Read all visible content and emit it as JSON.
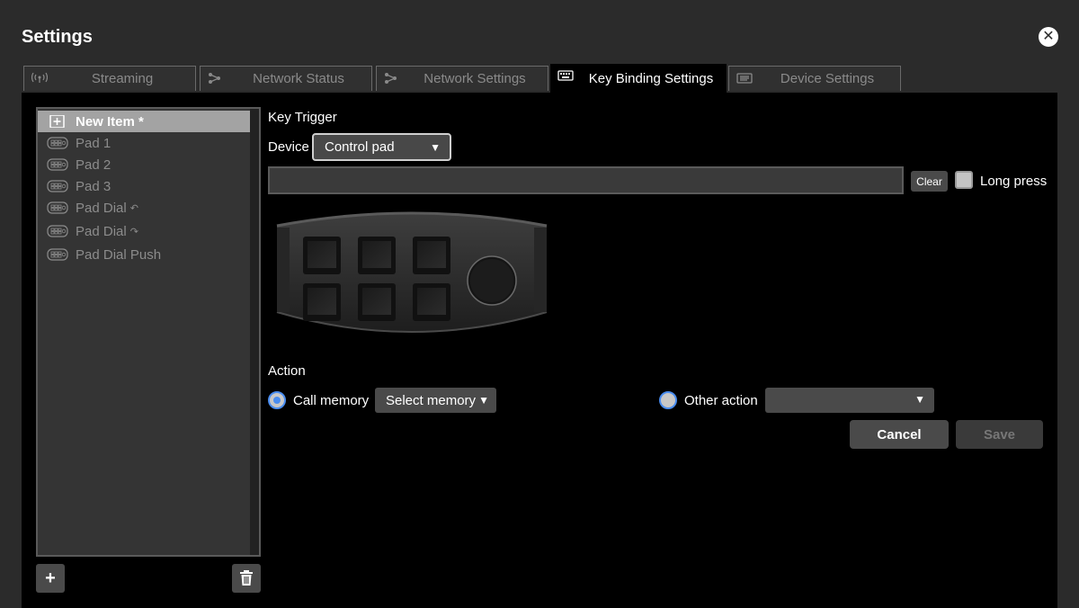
{
  "window": {
    "title": "Settings"
  },
  "tabs": [
    {
      "label": "Streaming",
      "icon": "broadcast-icon"
    },
    {
      "label": "Network Status",
      "icon": "network-icon"
    },
    {
      "label": "Network Settings",
      "icon": "network-icon"
    },
    {
      "label": "Key Binding Settings",
      "icon": "keyboard-icon"
    },
    {
      "label": "Device Settings",
      "icon": "device-icon"
    }
  ],
  "active_tab": "Key Binding Settings",
  "sidebar": {
    "items": [
      {
        "label": "New Item *",
        "icon": "add-box-icon",
        "selected": true
      },
      {
        "label": "Pad 1",
        "icon": "control-pad-icon"
      },
      {
        "label": "Pad 2",
        "icon": "control-pad-icon"
      },
      {
        "label": "Pad 3",
        "icon": "control-pad-icon"
      },
      {
        "label": "Pad Dial",
        "icon": "control-pad-icon",
        "suffix": "↶"
      },
      {
        "label": "Pad Dial",
        "icon": "control-pad-icon",
        "suffix": "↷"
      },
      {
        "label": "Pad Dial Push",
        "icon": "control-pad-icon"
      }
    ],
    "add_label": "+",
    "delete_icon": "trash-icon"
  },
  "key_trigger": {
    "section_label": "Key Trigger",
    "device_label": "Device",
    "device_value": "Control pad",
    "trigger_value": "",
    "clear_label": "Clear",
    "long_press_label": "Long press",
    "long_press_checked": false
  },
  "action": {
    "section_label": "Action",
    "call_memory_label": "Call memory",
    "call_memory_checked": true,
    "select_memory_label": "Select memory",
    "other_action_label": "Other action",
    "other_action_value": ""
  },
  "buttons": {
    "cancel": "Cancel",
    "save": "Save"
  },
  "colors": {
    "accent": "#4a8df0",
    "panel": "#000000",
    "background": "#2b2b2b"
  }
}
